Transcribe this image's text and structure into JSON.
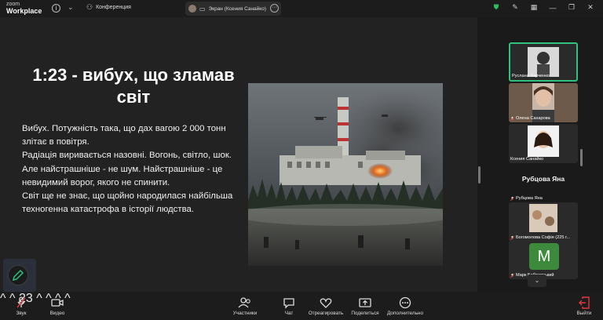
{
  "app": {
    "brand_top": "zoom",
    "brand_bottom": "Workplace"
  },
  "titlebar": {
    "conference_label": "Конференция",
    "share_tab_label": "Экран (Ксения Санайко)"
  },
  "slide": {
    "title": "1:23 - вибух, що зламав світ",
    "paragraphs": [
      "Вибух. Потужність така, що дах вагою 2 000 тонн злітає в повітря.",
      " Радіація виривається назовні. Вогонь, світло, шок.",
      " Але найстрашніше - не шум. Найстрашніше - це невидимий ворог, якого не спинити.",
      " Світ ще не знає, що щойно народилася найбільша техногенна катастрофа в історії людства."
    ]
  },
  "gallery": {
    "tiles": [
      {
        "name": "Руслана Харченко"
      },
      {
        "name": "Олена Сахарова"
      },
      {
        "name": "Ксения Санайко"
      }
    ],
    "big_name": "Рубцова Яна",
    "name_tiles": [
      {
        "name": "Рубцова Яна"
      },
      {
        "name": "Богомолова Софія (225 г..."
      },
      {
        "name": "Марк Бобровський",
        "avatar_letter": "M"
      }
    ]
  },
  "toolbar": {
    "mute": "Звук",
    "video": "Видео",
    "participants": "Участники",
    "participants_count": "23",
    "chat": "Чат",
    "react": "Отреагировать",
    "share": "Поделиться",
    "more": "Дополнительно",
    "leave": "Выйти"
  },
  "colors": {
    "accent_green": "#2ec27e",
    "leave_red": "#e0393e",
    "shield_green": "#2bbf5b"
  }
}
